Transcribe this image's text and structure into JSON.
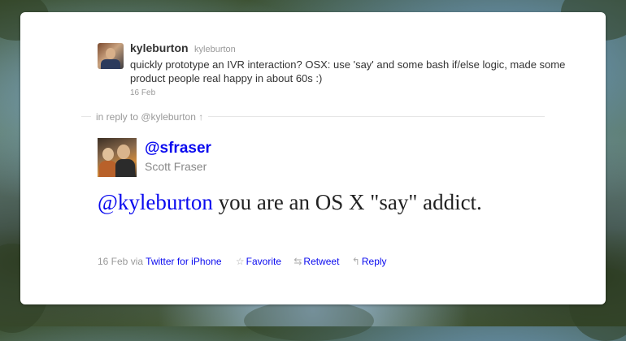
{
  "parent_tweet": {
    "screen_name": "kyleburton",
    "handle": "kyleburton",
    "text": "quickly prototype an IVR interaction? OSX: use 'say' and some bash if/else logic, made some product people real happy in about 60s :)",
    "timestamp": "16 Feb"
  },
  "in_reply_to": {
    "label": "in reply to @kyleburton",
    "arrow": "↑"
  },
  "tweet": {
    "screen_name": "@sfraser",
    "full_name": "Scott Fraser",
    "mention": "@kyleburton",
    "text_rest": " you are an OS X \"say\" addict.",
    "timestamp": "16 Feb",
    "via_label": "via",
    "source": "Twitter for iPhone",
    "actions": {
      "favorite": "Favorite",
      "retweet": "Retweet",
      "reply": "Reply"
    }
  },
  "colors": {
    "link": "#0a0aef",
    "muted": "#999999"
  }
}
